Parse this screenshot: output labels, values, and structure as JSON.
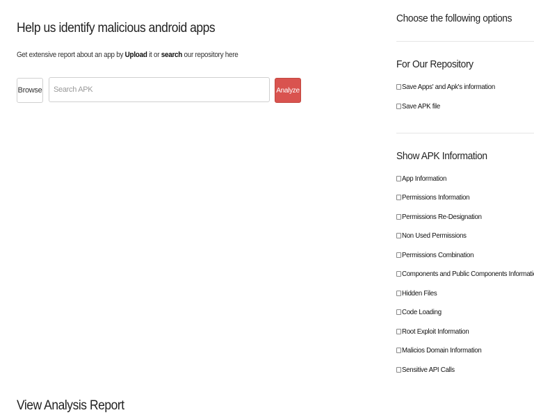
{
  "main": {
    "title": "Help us identify malicious android apps",
    "subtitle": {
      "prefix": "Get extensive report about an app by ",
      "upload": "Upload",
      "middle": " it or ",
      "search": "search",
      "suffix": " our repository here"
    },
    "browse_label": "Browse",
    "search_placeholder": "Search APK",
    "search_value": "",
    "analyze_label": "Analyze",
    "report_title": "View Analysis Report"
  },
  "sidebar": {
    "heading": "Choose the following options",
    "repository": {
      "heading": "For Our Repository",
      "options": [
        {
          "label": "Save Apps' and Apk's information",
          "checked": false
        },
        {
          "label": "Save APK file",
          "checked": false
        }
      ]
    },
    "info": {
      "heading": "Show APK Information",
      "options": [
        {
          "label": "App Information",
          "checked": false
        },
        {
          "label": "Permissions Information",
          "checked": false
        },
        {
          "label": "Permissions Re-Designation",
          "checked": false
        },
        {
          "label": "Non Used Permissions",
          "checked": false
        },
        {
          "label": "Permissions Combination",
          "checked": false
        },
        {
          "label": "Components and Public Components Information",
          "checked": false
        },
        {
          "label": "Hidden Files",
          "checked": false
        },
        {
          "label": "Code Loading",
          "checked": false
        },
        {
          "label": "Root Exploit Information",
          "checked": false
        },
        {
          "label": "Malicios Domain Information",
          "checked": false
        },
        {
          "label": "Sensitive API Calls",
          "checked": false
        }
      ]
    }
  },
  "colors": {
    "analyze_button": "#d9534f",
    "border": "#cfcfcf",
    "divider": "#e6e6e6"
  }
}
